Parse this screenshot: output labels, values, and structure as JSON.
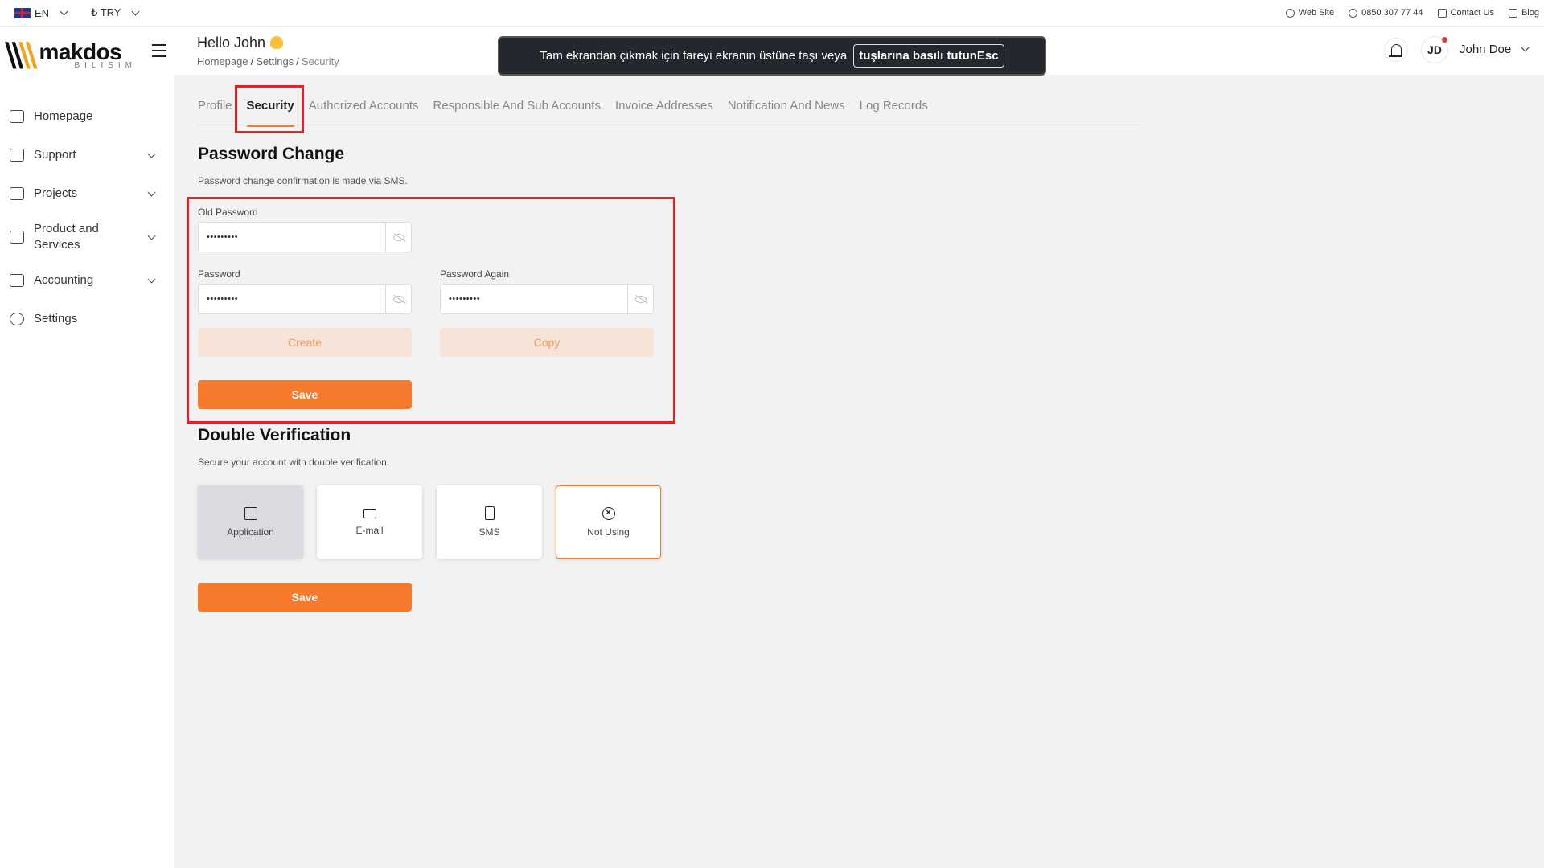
{
  "topbar": {
    "language": "EN",
    "currency": "₺ TRY",
    "links": [
      {
        "label": "Web Site",
        "icon": "globe-icon"
      },
      {
        "label": "0850 307 77 44",
        "icon": "headset-icon"
      },
      {
        "label": "Contact Us",
        "icon": "mail-icon"
      },
      {
        "label": "Blog",
        "icon": "edit-icon"
      }
    ]
  },
  "brand": {
    "name": "makdos",
    "sub": "BILISIM",
    "accent": "#f7a21b"
  },
  "sidebar": {
    "items": [
      {
        "label": "Homepage",
        "icon": "home-icon"
      },
      {
        "label": "Support",
        "icon": "chat-icon"
      },
      {
        "label": "Projects",
        "icon": "folder-icon"
      },
      {
        "label": "Product and Services",
        "icon": "list-icon"
      },
      {
        "label": "Accounting",
        "icon": "coins-icon"
      },
      {
        "label": "Settings",
        "icon": "gear-icon"
      }
    ]
  },
  "header": {
    "greeting": "Hello John",
    "breadcrumb": [
      "Homepage",
      "Settings",
      "Security"
    ],
    "user_initials": "JD",
    "user_name": "John Doe"
  },
  "toast": {
    "message": "Tam ekrandan çıkmak için fareyi ekranın üstüne taşı veya",
    "key_hint": "tuşlarına basılı tutunEsc"
  },
  "tabs": [
    "Profile",
    "Security",
    "Authorized Accounts",
    "Responsible And Sub Accounts",
    "Invoice Addresses",
    "Notification And News",
    "Log Records"
  ],
  "active_tab": "Security",
  "password_change": {
    "title": "Password Change",
    "description": "Password change confirmation is made via SMS.",
    "old_password_label": "Old Password",
    "old_password_value": "•••••••••",
    "password_label": "Password",
    "password_value": "•••••••••",
    "password_again_label": "Password Again",
    "password_again_value": "•••••••••",
    "create_label": "Create",
    "copy_label": "Copy",
    "save_label": "Save"
  },
  "double_verification": {
    "title": "Double Verification",
    "description": "Secure your account with double verification.",
    "options": [
      {
        "label": "Application",
        "icon": "devices-icon"
      },
      {
        "label": "E-mail",
        "icon": "mail-icon"
      },
      {
        "label": "SMS",
        "icon": "phone-icon"
      },
      {
        "label": "Not Using",
        "icon": "close-circle-icon"
      }
    ],
    "save_label": "Save"
  },
  "colors": {
    "accent": "#f7792b",
    "highlight": "#e01f27",
    "soft": "#f7e4d8"
  }
}
